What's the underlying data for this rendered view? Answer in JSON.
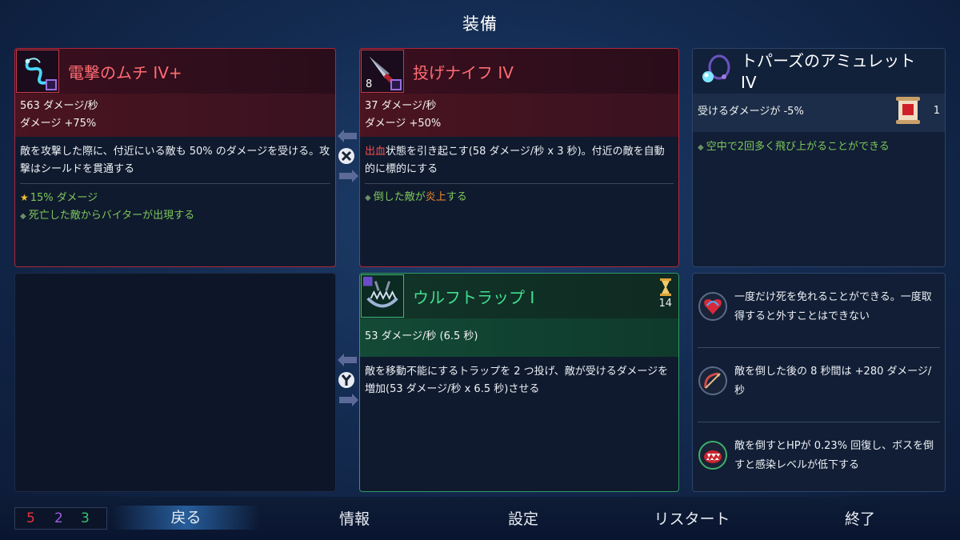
{
  "title": "装備",
  "weapon1": {
    "name": "電撃のムチ IV+",
    "stat1": "563 ダメージ/秒",
    "stat2": "ダメージ +75%",
    "desc": "敵を攻撃した際に、付近にいる敵も 50% のダメージを受ける。攻撃はシールドを貫通する",
    "bonus1": "15% ダメージ",
    "bonus2": "死亡した敵からバイターが出現する"
  },
  "weapon2": {
    "name": "投げナイフ IV",
    "count": "8",
    "stat1": "37 ダメージ/秒",
    "stat2": "ダメージ +50%",
    "desc_highlight": "出血",
    "desc_rest": "状態を引き起こす(58 ダメージ/秒 x 3 秒)。付近の敵を自動的に標的にする",
    "bonus_pre": "倒した敵が",
    "bonus_highlight": "炎上",
    "bonus_post": "する"
  },
  "amulet": {
    "name": "トパーズのアミュレット IV",
    "stat": "受けるダメージが -5%",
    "scroll_count": "1",
    "bonus": "空中で2回多く飛び上がることができる"
  },
  "skill": {
    "name": "ウルフトラップ I",
    "cooldown": "14",
    "stat": "53 ダメージ/秒 (6.5 秒)",
    "desc": "敵を移動不能にするトラップを 2 つ投げ、敵が受けるダメージを増加(53 ダメージ/秒 x 6.5 秒)させる"
  },
  "mutations": [
    {
      "icon": "heart-revive-icon",
      "text": "一度だけ死を免れることができる。一度取得すると外すことはできない"
    },
    {
      "icon": "bow-arrow-icon",
      "text": "敵を倒した後の 8 秒間は +280 ダメージ/秒"
    },
    {
      "icon": "fanged-mouth-icon",
      "text": "敵を倒すとHPが 0.23% 回復し、ボスを倒すと感染レベルが低下する"
    }
  ],
  "swap_buttons": {
    "top": "X",
    "bottom": "Y"
  },
  "scrolls": {
    "brutality": "5",
    "tactics": "2",
    "survival": "3"
  },
  "menu": {
    "back": "戻る",
    "info": "情報",
    "settings": "設定",
    "restart": "リスタート",
    "quit": "終了"
  },
  "colors": {
    "brutality": "#e8333a",
    "tactics": "#a05ce0",
    "survival": "#34c46a"
  }
}
